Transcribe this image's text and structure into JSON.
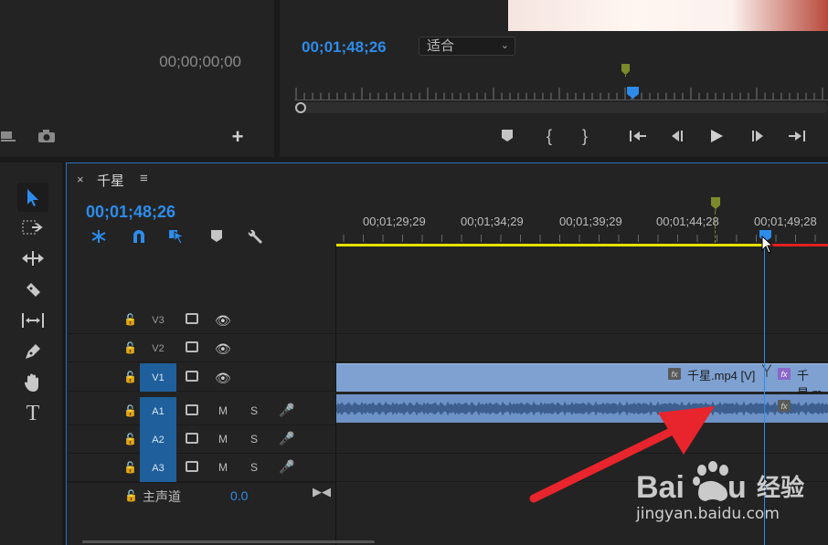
{
  "source_monitor": {
    "timecode": "00;00;00;00"
  },
  "program_monitor": {
    "timecode": "00;01;48;26",
    "fit_select": "适合"
  },
  "timeline": {
    "close": "×",
    "title": "千星",
    "menu": "≡",
    "timecode": "00;01;48;26",
    "ruler_ticks": [
      "00;01;29;29",
      "00;01;34;29",
      "00;01;39;29",
      "00;01;44;28",
      "00;01;49;28"
    ],
    "tracks": [
      {
        "name": "V3",
        "type": "video",
        "target": false
      },
      {
        "name": "V2",
        "type": "video",
        "target": false
      },
      {
        "name": "V1",
        "type": "video",
        "target": true
      },
      {
        "name": "A1",
        "type": "audio",
        "target": true
      },
      {
        "name": "A2",
        "type": "audio",
        "target": true
      },
      {
        "name": "A3",
        "type": "audio",
        "target": true
      }
    ],
    "track_buttons": {
      "mute": "M",
      "solo": "S"
    },
    "clips": {
      "video_clip_1": "千星.mp4 [V]",
      "video_clip_2": "千星.m",
      "fx": "fx"
    },
    "master": {
      "label": "主声道",
      "value": "0.0"
    }
  },
  "watermark": {
    "site": "jingyan.baidu.com",
    "brand": "Baidu",
    "sub": "经验"
  },
  "colors": {
    "accent_blue": "#2d8ceb",
    "work_area": "#e6e000",
    "arrow": "#e8242c",
    "video_clip": "#7ea1d2",
    "audio_clip": "#6e92c6",
    "target_track": "#1f5f9b"
  }
}
